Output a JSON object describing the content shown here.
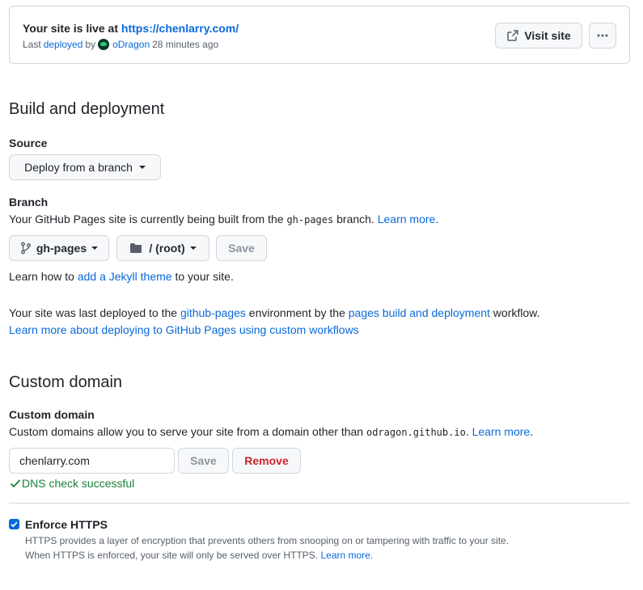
{
  "banner": {
    "live_prefix": "Your site is live at ",
    "live_url": "https://chenlarry.com/",
    "last": "Last",
    "deployed_link": "deployed",
    "by": "by",
    "user": "oDragon",
    "time": "28 minutes ago",
    "visit_label": "Visit site",
    "more_icon": "kebab-horizontal-icon"
  },
  "build": {
    "heading": "Build and deployment",
    "source_label": "Source",
    "source_value": "Deploy from a branch",
    "branch_label": "Branch",
    "branch_desc_prefix": "Your GitHub Pages site is currently being built from the ",
    "branch_code": "gh-pages",
    "branch_desc_suffix": " branch. ",
    "learn_more": "Learn more",
    "period": ".",
    "branch_value": "gh-pages",
    "folder_value": "/ (root)",
    "save_label": "Save",
    "jekyll_prefix": "Learn how to ",
    "jekyll_link": "add a Jekyll theme",
    "jekyll_suffix": " to your site.",
    "deployed_prefix": "Your site was last deployed to the ",
    "env_link": "github-pages",
    "deployed_mid": " environment by the ",
    "workflow_link": "pages build and deployment",
    "deployed_suffix": " workflow.",
    "custom_workflows_link": "Learn more about deploying to GitHub Pages using custom workflows"
  },
  "domain": {
    "heading": "Custom domain",
    "label": "Custom domain",
    "desc_prefix": "Custom domains allow you to serve your site from a domain other than ",
    "desc_code": "odragon.github.io",
    "desc_suffix": ". ",
    "learn_more": "Learn more",
    "period": ".",
    "input_value": "chenlarry.com",
    "save_label": "Save",
    "remove_label": "Remove",
    "dns_status": "DNS check successful",
    "status_color": "#1a7f37"
  },
  "https": {
    "label": "Enforce HTTPS",
    "checked": true,
    "line1": "HTTPS provides a layer of encryption that prevents others from snooping on or tampering with traffic to your site.",
    "line2_prefix": "When HTTPS is enforced, your site will only be served over HTTPS. ",
    "learn_more": "Learn more",
    "period": "."
  }
}
